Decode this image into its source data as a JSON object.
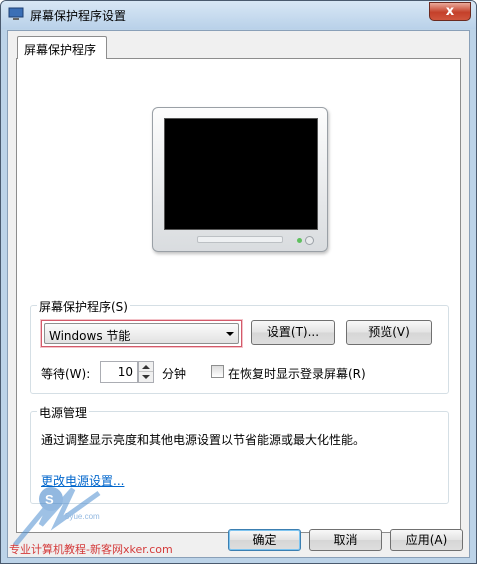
{
  "window": {
    "title": "屏幕保护程序设置",
    "close_glyph": "x"
  },
  "tabs": [
    {
      "label": "屏幕保护程序"
    }
  ],
  "screensaver": {
    "group_label": "屏幕保护程序(S)",
    "selected": "Windows 节能",
    "settings_button": "设置(T)...",
    "preview_button": "预览(V)",
    "wait_label": "等待(W):",
    "wait_value": "10",
    "minutes_label": "分钟",
    "resume_checkbox_label": "在恢复时显示登录屏幕(R)",
    "resume_checked": false
  },
  "power": {
    "group_label": "电源管理",
    "description": "通过调整显示亮度和其他电源设置以节省能源或最大化性能。",
    "link": "更改电源设置..."
  },
  "buttons": {
    "ok": "确定",
    "cancel": "取消",
    "apply": "应用(A)"
  },
  "watermark": {
    "text": "专业计算机教程-新客网xker.com",
    "logo_text": "5yue.com"
  },
  "colors": {
    "link": "#0066cc",
    "highlight_border": "#d35a6a"
  }
}
